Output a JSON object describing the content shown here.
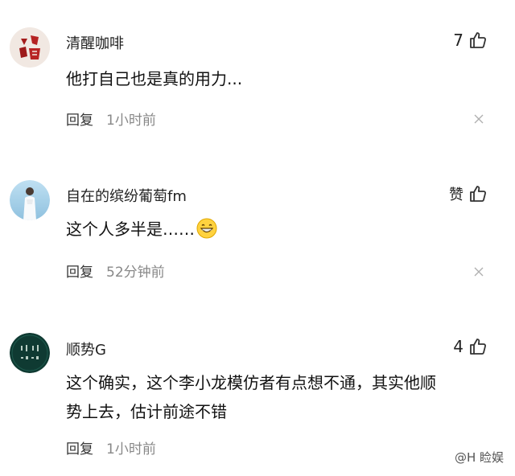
{
  "comments": [
    {
      "username": "清醒咖啡",
      "likes": "7",
      "text": "他打自己也是真的用力...",
      "reply_label": "回复",
      "time": "1小时前"
    },
    {
      "username": "自在的缤纷葡萄fm",
      "likes": "赞",
      "text": "这个人多半是……",
      "reply_label": "回复",
      "time": "52分钟前"
    },
    {
      "username": "顺势G",
      "likes": "4",
      "text_line1": "这个确实，这个李小龙模仿者有点想不通，其实他顺",
      "text_line2": "势上去，估计前途不错",
      "reply_label": "回复",
      "time": "1小时前"
    }
  ],
  "watermark": "@H 睑娱",
  "icons": {
    "like": "thumbs-up-icon",
    "close": "close-icon",
    "emoji": "grinning-face-icon"
  },
  "colors": {
    "text_primary": "#111111",
    "text_secondary": "#888888",
    "icon": "#333333"
  }
}
